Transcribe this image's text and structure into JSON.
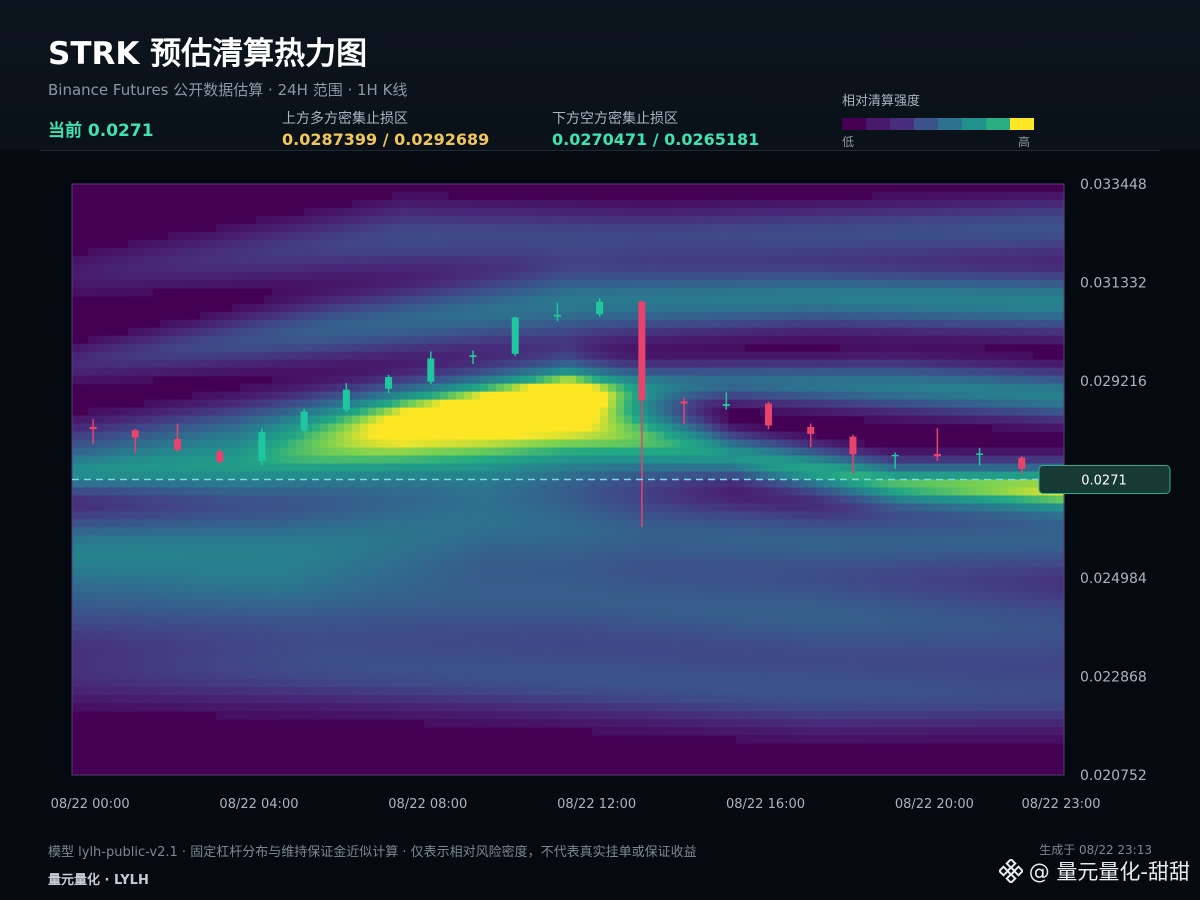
{
  "header": {
    "title": "STRK 预估清算热力图",
    "subtitle": "Binance Futures 公开数据估算 · 24H 范围 · 1H K线",
    "current": "当前 0.0271",
    "upper_zone_label": "上方多方密集止损区",
    "upper_zone_value": "0.0287399 / 0.0292689",
    "lower_zone_label": "下方空方密集止损区",
    "lower_zone_value": "0.0270471 / 0.0265181"
  },
  "legend": {
    "title": "相对清算强度",
    "low": "低",
    "high": "高",
    "colors": [
      "#440154",
      "#48186a",
      "#472d7b",
      "#3b528b",
      "#2c728e",
      "#21918c",
      "#28ae80",
      "#fde725"
    ]
  },
  "chart_data": {
    "type": "heatmap",
    "ylim": [
      0.020752,
      0.033448
    ],
    "y_ticks": [
      "0.033448",
      "0.031332",
      "0.029216",
      "0.024984",
      "0.022868",
      "0.020752"
    ],
    "x_ticks": [
      "08/22 00:00",
      "08/22 04:00",
      "08/22 08:00",
      "08/22 12:00",
      "08/22 16:00",
      "08/22 20:00",
      "08/22 23:00"
    ],
    "current_price": 0.0271,
    "current_label": "0.0271",
    "up_color": "#1fc7a0",
    "down_color": "#e8436d",
    "candles": [
      {
        "o": 0.02823,
        "h": 0.0284,
        "l": 0.02786,
        "c": 0.02818
      },
      {
        "o": 0.02816,
        "h": 0.02818,
        "l": 0.02766,
        "c": 0.028
      },
      {
        "o": 0.02797,
        "h": 0.0283,
        "l": 0.0277,
        "c": 0.02774
      },
      {
        "o": 0.0277,
        "h": 0.02775,
        "l": 0.02745,
        "c": 0.02748
      },
      {
        "o": 0.0275,
        "h": 0.0282,
        "l": 0.0274,
        "c": 0.02812
      },
      {
        "o": 0.02815,
        "h": 0.02862,
        "l": 0.02812,
        "c": 0.02856
      },
      {
        "o": 0.0286,
        "h": 0.02917,
        "l": 0.02855,
        "c": 0.02903
      },
      {
        "o": 0.02905,
        "h": 0.02935,
        "l": 0.02895,
        "c": 0.0293
      },
      {
        "o": 0.0292,
        "h": 0.02985,
        "l": 0.02915,
        "c": 0.0297
      },
      {
        "o": 0.02973,
        "h": 0.02987,
        "l": 0.02958,
        "c": 0.02977
      },
      {
        "o": 0.0298,
        "h": 0.0306,
        "l": 0.02975,
        "c": 0.03058
      },
      {
        "o": 0.0306,
        "h": 0.0309,
        "l": 0.0305,
        "c": 0.03064
      },
      {
        "o": 0.03065,
        "h": 0.031,
        "l": 0.0306,
        "c": 0.03092
      },
      {
        "o": 0.03092,
        "h": 0.03094,
        "l": 0.02608,
        "c": 0.0288
      },
      {
        "o": 0.02878,
        "h": 0.02886,
        "l": 0.02828,
        "c": 0.02873
      },
      {
        "o": 0.02868,
        "h": 0.02897,
        "l": 0.0286,
        "c": 0.02872
      },
      {
        "o": 0.02873,
        "h": 0.02877,
        "l": 0.02818,
        "c": 0.02826
      },
      {
        "o": 0.02823,
        "h": 0.0283,
        "l": 0.0278,
        "c": 0.02808
      },
      {
        "o": 0.02802,
        "h": 0.02806,
        "l": 0.02722,
        "c": 0.02764
      },
      {
        "o": 0.0276,
        "h": 0.02768,
        "l": 0.02733,
        "c": 0.02763
      },
      {
        "o": 0.02765,
        "h": 0.0282,
        "l": 0.0275,
        "c": 0.0276
      },
      {
        "o": 0.02763,
        "h": 0.02778,
        "l": 0.0274,
        "c": 0.02766
      },
      {
        "o": 0.02757,
        "h": 0.0276,
        "l": 0.02723,
        "c": 0.02733
      }
    ],
    "bands": [
      {
        "x": [
          0,
          4,
          8,
          12,
          16,
          20,
          24
        ],
        "y": [
          0.0272,
          0.02735,
          0.0279,
          0.0283,
          0.0276,
          0.027,
          0.0269
        ],
        "w": [
          0.0004,
          0.0006,
          0.0009,
          0.0011,
          0.00045,
          0.00045,
          0.0005
        ],
        "a": [
          0.45,
          0.6,
          0.88,
          1.0,
          0.65,
          0.8,
          0.95
        ]
      },
      {
        "x": [
          0,
          6,
          12,
          16,
          20,
          24
        ],
        "y": [
          0.0277,
          0.0284,
          0.029,
          0.0292,
          0.0291,
          0.0289
        ],
        "w": [
          0.0006,
          0.0006,
          0.0005,
          0.0004,
          0.0005,
          0.0005
        ],
        "a": [
          0.3,
          0.42,
          0.58,
          0.45,
          0.52,
          0.55
        ]
      },
      {
        "x": [
          0,
          6,
          12,
          18,
          24
        ],
        "y": [
          0.0296,
          0.0303,
          0.0309,
          0.031,
          0.0309
        ],
        "w": [
          0.0004,
          0.0006,
          0.0007,
          0.0006,
          0.0006
        ],
        "a": [
          0.15,
          0.38,
          0.5,
          0.52,
          0.56
        ]
      },
      {
        "x": [
          0,
          8,
          14,
          20,
          24
        ],
        "y": [
          0.0315,
          0.0323,
          0.0323,
          0.0324,
          0.0325
        ],
        "w": [
          0.0005,
          0.0007,
          0.0006,
          0.0006,
          0.0006
        ],
        "a": [
          0.1,
          0.28,
          0.26,
          0.3,
          0.32
        ]
      },
      {
        "x": [
          0,
          5,
          10,
          14,
          18,
          24
        ],
        "y": [
          0.0256,
          0.0257,
          0.0262,
          0.026,
          0.0258,
          0.0258
        ],
        "w": [
          0.0008,
          0.001,
          0.001,
          0.0008,
          0.0007,
          0.0007
        ],
        "a": [
          0.5,
          0.45,
          0.42,
          0.35,
          0.36,
          0.38
        ]
      },
      {
        "x": [
          0,
          6,
          12,
          18,
          24
        ],
        "y": [
          0.0244,
          0.0245,
          0.0245,
          0.0242,
          0.0239
        ],
        "w": [
          0.0009,
          0.001,
          0.001,
          0.001,
          0.001
        ],
        "a": [
          0.3,
          0.32,
          0.35,
          0.38,
          0.32
        ]
      },
      {
        "x": [
          0,
          6,
          12,
          18,
          24
        ],
        "y": [
          0.0229,
          0.023,
          0.0228,
          0.0225,
          0.0224
        ],
        "w": [
          0.0007,
          0.0008,
          0.0008,
          0.0008,
          0.0007
        ],
        "a": [
          0.15,
          0.26,
          0.3,
          0.3,
          0.25
        ]
      }
    ]
  },
  "footer": {
    "note": "模型 lylh-public-v2.1 · 固定杠杆分布与维持保证金近似计算 · 仅表示相对风险密度，不代表真实挂单或保证收益",
    "brand": "量元量化 · LYLH",
    "generated": "生成于 08/22 23:13",
    "watermark": "@ 量元量化-甜甜"
  }
}
